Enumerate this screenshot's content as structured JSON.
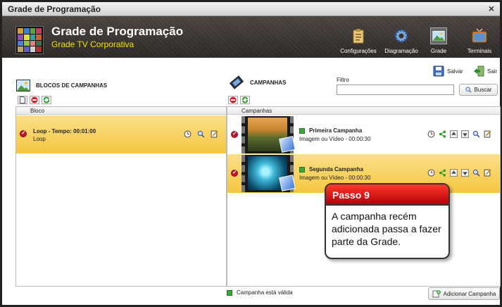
{
  "window": {
    "title": "Grade de Programação",
    "close_glyph": "×"
  },
  "header": {
    "title": "Grade de Programação",
    "subtitle": "Grade TV Corporativa",
    "nav": [
      {
        "label": "Configurações",
        "icon": "clipboard-icon"
      },
      {
        "label": "Diagramação",
        "icon": "gear-icon"
      },
      {
        "label": "Grade",
        "icon": "picture-icon"
      },
      {
        "label": "Terminais",
        "icon": "tv-icon"
      }
    ]
  },
  "toolbar": {
    "save_label": "Salvar",
    "exit_label": "Sair"
  },
  "filter": {
    "label": "Filtro",
    "value": "",
    "search_label": "Buscar"
  },
  "blocks_panel": {
    "title": "BLOCOS DE CAMPANHAS",
    "column_header": "Bloco",
    "rows": [
      {
        "title": "Loop - Tempo: 00:01:00",
        "subtitle": "Loop"
      }
    ]
  },
  "campaigns_panel": {
    "title": "CAMPANHAS",
    "column_header": "Campanhas",
    "rows": [
      {
        "name": "Primeira Campanha",
        "detail": "Imagem ou Vídeo - 00:00:30"
      },
      {
        "name": "Segunda Campanha",
        "detail": "Imagem ou Vídeo - 00:00:30"
      }
    ]
  },
  "legend": {
    "label": "Campanha está válida",
    "color": "#3aa93a"
  },
  "add_button": {
    "label": "Adicionar Campanha"
  },
  "callout": {
    "title": "Passo 9",
    "body": "A campanha recém adicionada passa a fazer parte da Grade."
  },
  "colors": {
    "accent_yellow": "#f2e200",
    "selected_row": "#f5c640",
    "callout_red": "#d0100a"
  }
}
